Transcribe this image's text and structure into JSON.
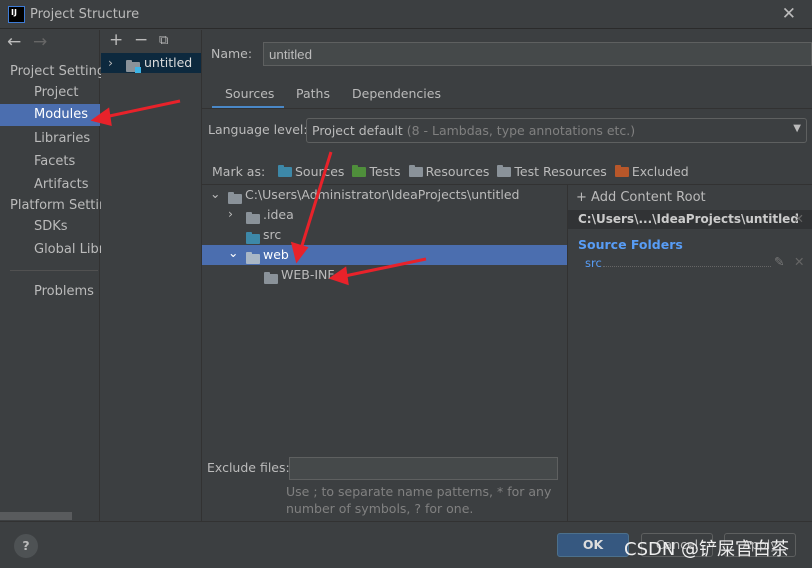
{
  "window": {
    "title": "Project Structure",
    "logo": "IJ"
  },
  "sidebar": {
    "sections": [
      {
        "label": "Project Settings",
        "items": [
          "Project",
          "Modules",
          "Libraries",
          "Facets",
          "Artifacts"
        ]
      },
      {
        "label": "Platform Settings",
        "items": [
          "SDKs",
          "Global Libraries"
        ]
      }
    ],
    "extra": "Problems",
    "selected": "Modules"
  },
  "modules": {
    "items": [
      "untitled"
    ]
  },
  "name": {
    "label": "Name:",
    "value": "untitled"
  },
  "tabs": [
    "Sources",
    "Paths",
    "Dependencies"
  ],
  "language": {
    "label": "Language level:",
    "value": "Project default",
    "hint": "(8 - Lambdas, type annotations etc.)"
  },
  "mark_as": {
    "label": "Mark as:",
    "items": [
      {
        "label": "Sources",
        "color": "#3d88a8"
      },
      {
        "label": "Tests",
        "color": "#4f8f3b"
      },
      {
        "label": "Resources",
        "color": "#8a9299"
      },
      {
        "label": "Test Resources",
        "color": "#8a9299"
      },
      {
        "label": "Excluded",
        "color": "#b8572a"
      }
    ]
  },
  "tree": [
    {
      "label": "C:\\Users\\Administrator\\IdeaProjects\\untitled"
    },
    {
      "label": ".idea"
    },
    {
      "label": "src"
    },
    {
      "label": "web"
    },
    {
      "label": "WEB-INF"
    }
  ],
  "roots": {
    "add": "Add Content Root",
    "path": "C:\\Users\\...\\IdeaProjects\\untitled",
    "source_folders": "Source Folders",
    "folders": [
      "src"
    ]
  },
  "exclude": {
    "label": "Exclude files:",
    "value": "",
    "hint1": "Use ; to separate name patterns, * for any",
    "hint2": "number of symbols, ? for one."
  },
  "buttons": {
    "ok": "OK",
    "cancel": "Cancel",
    "apply": "Apply",
    "help": "?"
  },
  "watermark": "CSDN @铲屎官白茶",
  "colors": {
    "selection": "#4b6eaf",
    "accent": "#4a88c7",
    "annotation": "#e8222a"
  }
}
